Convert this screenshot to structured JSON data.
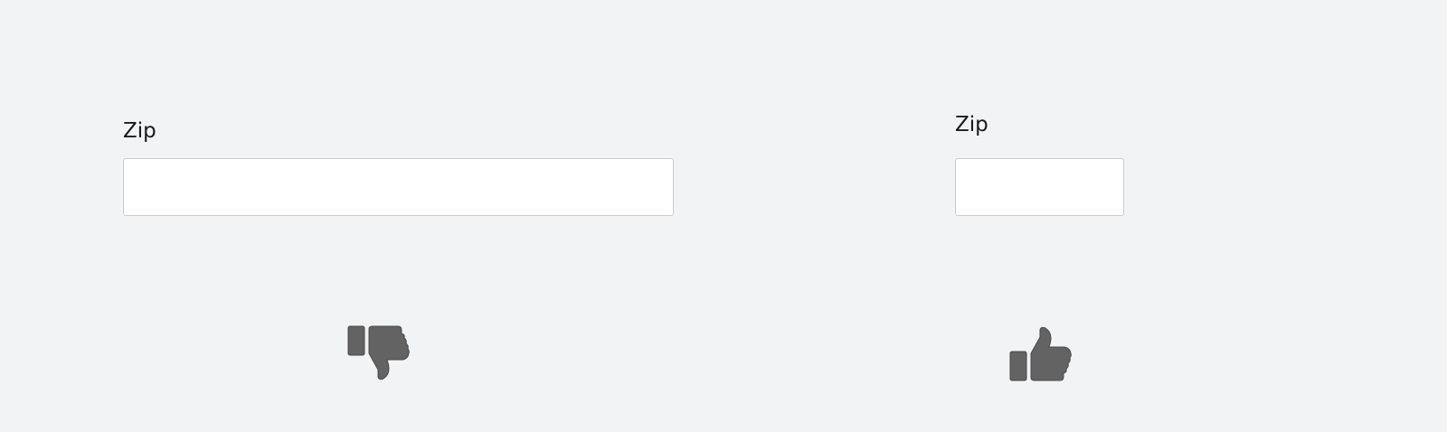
{
  "example_bad": {
    "label": "Zip",
    "input_value": "",
    "verdict_icon": "thumbs-down-icon"
  },
  "example_good": {
    "label": "Zip",
    "input_value": "",
    "verdict_icon": "thumbs-up-icon"
  },
  "colors": {
    "background": "#f2f3f5",
    "icon_fill": "#636363",
    "input_border": "#c9ccd1"
  }
}
